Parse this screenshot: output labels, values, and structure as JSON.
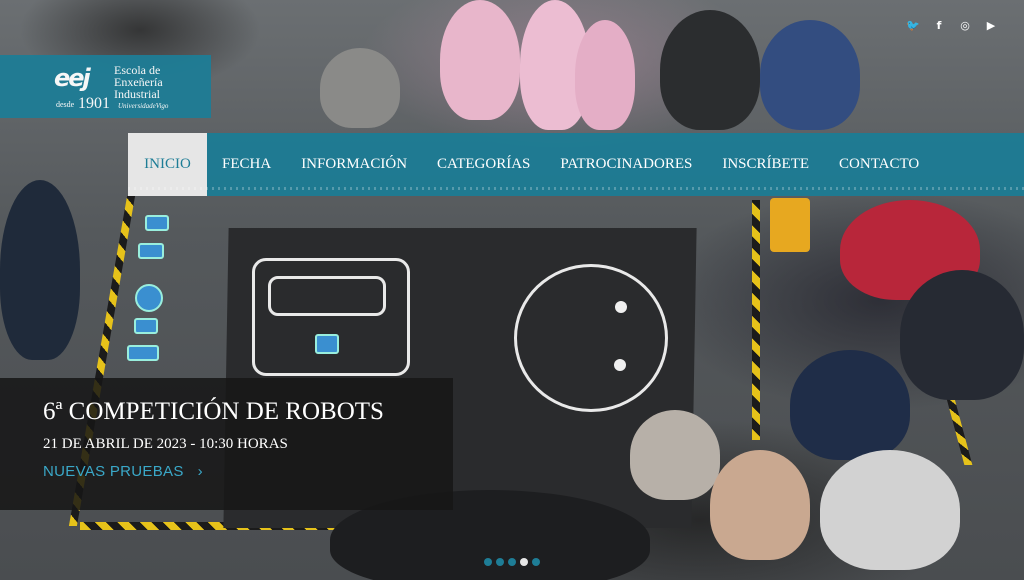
{
  "logo": {
    "mark": "eej",
    "name_line1": "Escola de",
    "name_line2": "Enxeñería",
    "name_line3": "Industrial",
    "desde": "desde",
    "year": "1901",
    "university": "UniversidadeVigo"
  },
  "social": {
    "items": [
      {
        "name": "twitter-icon",
        "glyph": "🐦"
      },
      {
        "name": "facebook-icon",
        "glyph": "f"
      },
      {
        "name": "instagram-icon",
        "glyph": "◎"
      },
      {
        "name": "youtube-icon",
        "glyph": "▶"
      }
    ]
  },
  "nav": {
    "items": [
      {
        "label": "INICIO",
        "active": true
      },
      {
        "label": "FECHA"
      },
      {
        "label": "INFORMACIÓN"
      },
      {
        "label": "CATEGORÍAS"
      },
      {
        "label": "PATROCINADORES"
      },
      {
        "label": "INSCRÍBETE"
      },
      {
        "label": "CONTACTO"
      }
    ]
  },
  "slide": {
    "title": "6ª COMPETICIÓN DE ROBOTS",
    "date": "21 DE ABRIL DE 2023 - 10:30 HORAS",
    "link": "NUEVAS PRUEBAS",
    "link_arrow": "›"
  },
  "carousel": {
    "count": 5,
    "active_index": 3
  },
  "colors": {
    "brand": "#1e7d96",
    "link": "#3aa8c8"
  }
}
